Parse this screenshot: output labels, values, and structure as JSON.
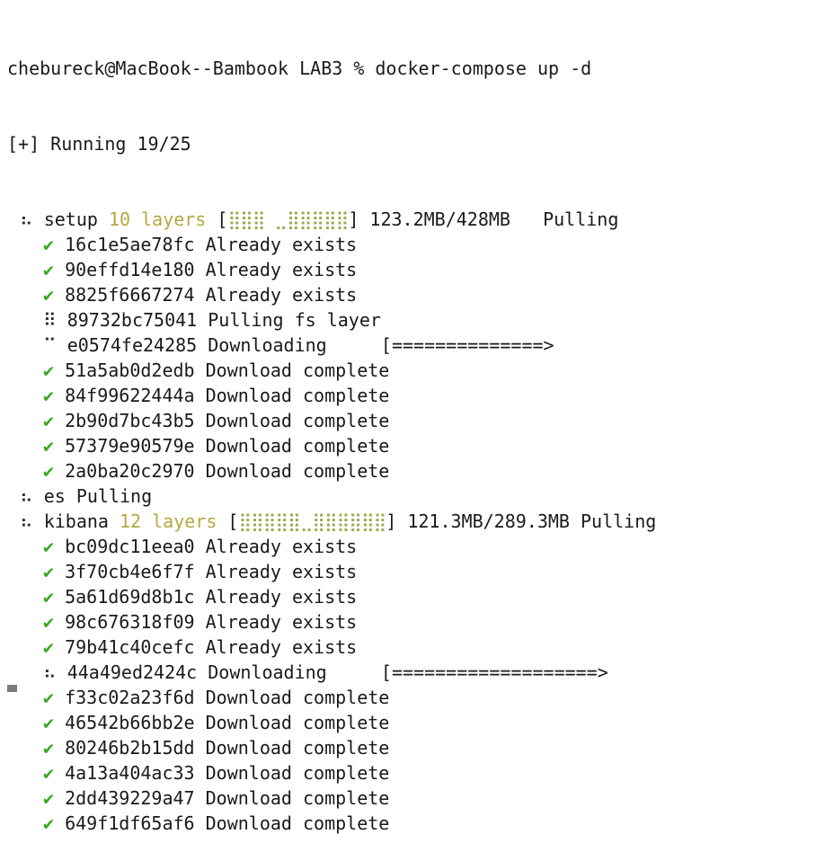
{
  "prompt": "chebureck@MacBook--Bambook LAB3 % docker-compose up -d",
  "running": "[+] Running 19/25",
  "services": [
    {
      "spinner": "⠦",
      "name": "setup",
      "layers": "10 layers",
      "bar_open": "[",
      "bar": "⣿⣿⣿ ⣀⣿⣿⣿⣿⣿",
      "bar_close": "]",
      "size": "123.2MB/428MB",
      "status": "Pulling",
      "items": [
        {
          "icon": "✔",
          "id": "16c1e5ae78fc",
          "text": "Already exists",
          "kind": "done"
        },
        {
          "icon": "✔",
          "id": "90effd14e180",
          "text": "Already exists",
          "kind": "done"
        },
        {
          "icon": "✔",
          "id": "8825f6667274",
          "text": "Already exists",
          "kind": "done"
        },
        {
          "icon": "⠿",
          "id": "89732bc75041",
          "text": "Pulling fs layer",
          "kind": "wait"
        },
        {
          "icon": "⠉",
          "id": "e0574fe24285",
          "text": "Downloading     [==============>",
          "kind": "wait"
        },
        {
          "icon": "✔",
          "id": "51a5ab0d2edb",
          "text": "Download complete",
          "kind": "done"
        },
        {
          "icon": "✔",
          "id": "84f99622444a",
          "text": "Download complete",
          "kind": "done"
        },
        {
          "icon": "✔",
          "id": "2b90d7bc43b5",
          "text": "Download complete",
          "kind": "done"
        },
        {
          "icon": "✔",
          "id": "57379e90579e",
          "text": "Download complete",
          "kind": "done"
        },
        {
          "icon": "✔",
          "id": "2a0ba20c2970",
          "text": "Download complete",
          "kind": "done"
        }
      ]
    },
    {
      "spinner": "⠦",
      "name": "es Pulling",
      "layers": "",
      "bar_open": "",
      "bar": "",
      "bar_close": "",
      "size": "",
      "status": "",
      "items": []
    },
    {
      "spinner": "⠦",
      "name": "kibana",
      "layers": "12 layers",
      "bar_open": "[",
      "bar": "⣿⣿⣿⣿⣿⣀⣿⣿⣿⣿⣿⣿",
      "bar_close": "]",
      "size": "121.3MB/289.3MB",
      "status": "Pulling",
      "items": [
        {
          "icon": "✔",
          "id": "bc09dc11eea0",
          "text": "Already exists",
          "kind": "done"
        },
        {
          "icon": "✔",
          "id": "3f70cb4e6f7f",
          "text": "Already exists",
          "kind": "done"
        },
        {
          "icon": "✔",
          "id": "5a61d69d8b1c",
          "text": "Already exists",
          "kind": "done"
        },
        {
          "icon": "✔",
          "id": "98c676318f09",
          "text": "Already exists",
          "kind": "done"
        },
        {
          "icon": "✔",
          "id": "79b41c40cefc",
          "text": "Already exists",
          "kind": "done"
        },
        {
          "icon": "⠦",
          "id": "44a49ed2424c",
          "text": "Downloading     [===================>",
          "kind": "wait"
        },
        {
          "icon": "✔",
          "id": "f33c02a23f6d",
          "text": "Download complete",
          "kind": "done"
        },
        {
          "icon": "✔",
          "id": "46542b66bb2e",
          "text": "Download complete",
          "kind": "done"
        },
        {
          "icon": "✔",
          "id": "80246b2b15dd",
          "text": "Download complete",
          "kind": "done"
        },
        {
          "icon": "✔",
          "id": "4a13a404ac33",
          "text": "Download complete",
          "kind": "done"
        },
        {
          "icon": "✔",
          "id": "2dd439229a47",
          "text": "Download complete",
          "kind": "done"
        },
        {
          "icon": "✔",
          "id": "649f1df65af6",
          "text": "Download complete",
          "kind": "done"
        }
      ]
    }
  ],
  "colors": {
    "check": "#3aa822",
    "layers": "#b5a93f",
    "text": "#1a1a1a",
    "background": "#ffffff"
  }
}
